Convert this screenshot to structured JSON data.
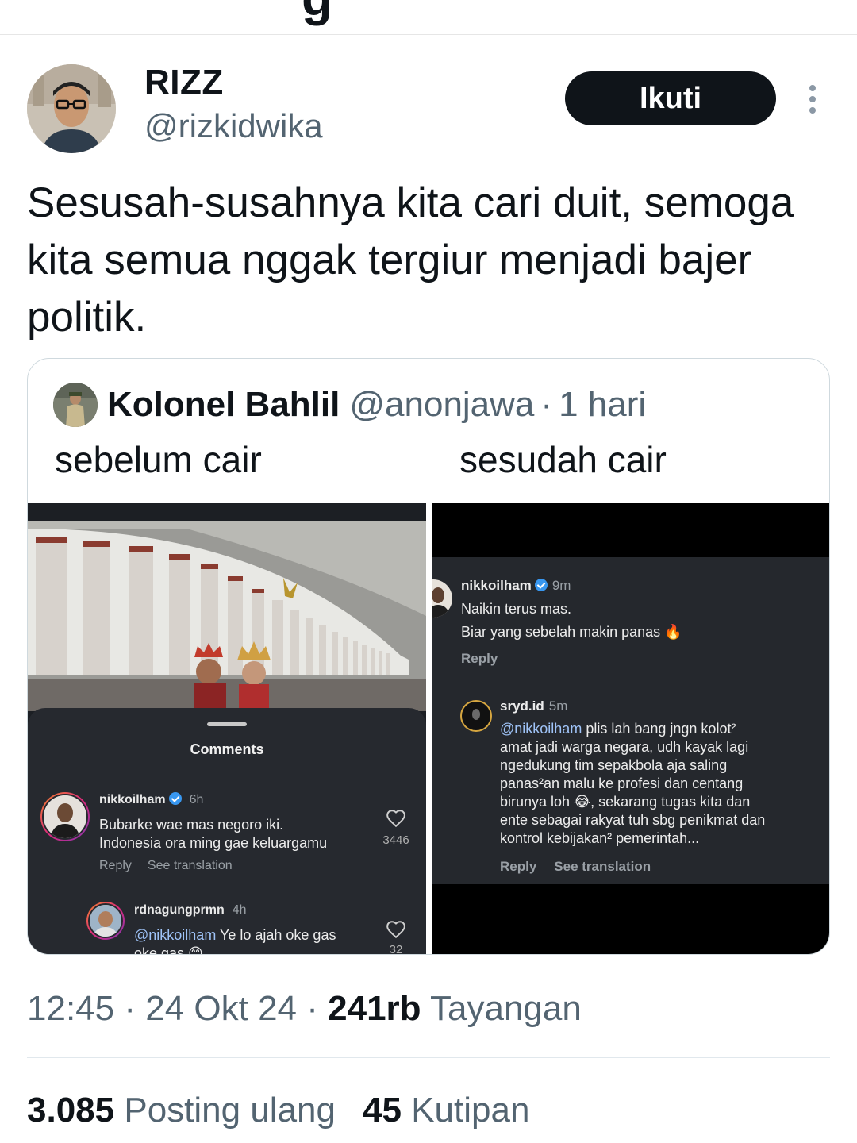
{
  "tweet": {
    "author_name": "RIZZ",
    "author_handle": "@rizkidwika",
    "follow_label": "Ikuti",
    "text": "Sesusah-susahnya kita cari duit, semoga kita semua nggak tergiur menjadi bajer politik."
  },
  "quote": {
    "author_name": "Kolonel Bahlil",
    "author_handle": "@anonjawa",
    "separator": "·",
    "time": "1 hari",
    "caption_left": "sebelum cair",
    "caption_right": "sesudah cair",
    "left_panel": {
      "title": "Comments",
      "comments": [
        {
          "user": "nikkoilham",
          "time": "6h",
          "line1": "Bubarke wae mas negoro iki.",
          "line2": "Indonesia ora ming gae keluargamu",
          "reply": "Reply",
          "translate": "See translation",
          "likes": "3446"
        },
        {
          "user": "rdnagungprmn",
          "time": "4h",
          "mention": "@nikkoilham",
          "line1": "Ye lo ajah oke gas",
          "line2": "oke gas 😊",
          "likes": "32"
        }
      ]
    },
    "right_panel": {
      "comments": [
        {
          "user": "nikkoilham",
          "time": "9m",
          "line1": "Naikin terus mas.",
          "line2": "Biar yang sebelah makin panas 🔥",
          "reply": "Reply"
        },
        {
          "user": "sryd.id",
          "time": "5m",
          "mention": "@nikkoilham",
          "line1": "plis lah bang jngn kolot²",
          "line2": "amat jadi warga negara, udh kayak lagi",
          "line3": "ngedukung tim sepakbola aja saling",
          "line4": "panas²an malu ke profesi dan centang",
          "line5": "birunya loh 😂, sekarang tugas kita dan",
          "line6": "ente sebagai rakyat tuh sbg penikmat dan",
          "line7": "kontrol kebijakan² pemerintah...",
          "reply": "Reply",
          "translate": "See translation"
        }
      ]
    }
  },
  "meta": {
    "time": "12:45",
    "sep1": "·",
    "date": "24 Okt 24",
    "sep2": "·",
    "views_count": "241rb",
    "views_label": "Tayangan"
  },
  "stats": {
    "reposts_count": "3.085",
    "reposts_label": "Posting ulang",
    "quotes_count": "45",
    "quotes_label": "Kutipan"
  },
  "icons": {
    "more": "more-vertical-icon",
    "heart": "heart-icon",
    "verified": "verified-badge-icon"
  }
}
